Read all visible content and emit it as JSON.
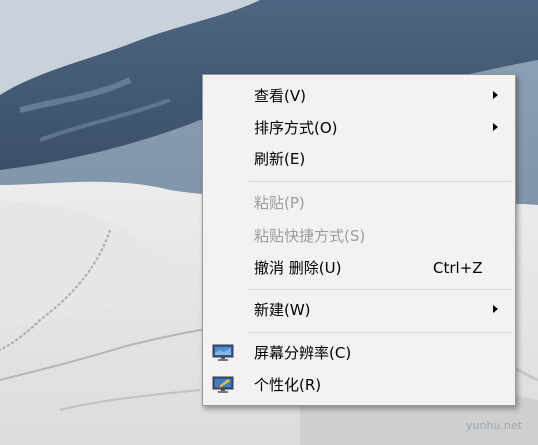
{
  "menu": {
    "items": [
      {
        "label": "查看(V)",
        "submenu": true
      },
      {
        "label": "排序方式(O)",
        "submenu": true
      },
      {
        "label": "刷新(E)"
      },
      {
        "label": "粘贴(P)",
        "disabled": true
      },
      {
        "label": "粘贴快捷方式(S)",
        "disabled": true
      },
      {
        "label": "撤消 删除(U)",
        "shortcut": "Ctrl+Z"
      },
      {
        "label": "新建(W)",
        "submenu": true
      },
      {
        "label": "屏幕分辨率(C)",
        "icon": "display-icon"
      },
      {
        "label": "个性化(R)",
        "icon": "personalize-icon"
      }
    ]
  },
  "watermark": "yunhu.net"
}
